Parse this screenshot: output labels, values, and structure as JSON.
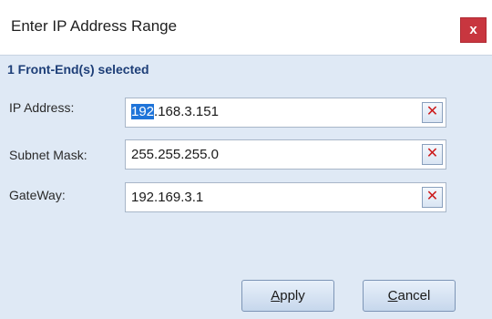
{
  "window": {
    "title": "Enter IP Address Range",
    "close_label": "x"
  },
  "form": {
    "selected_text": "1 Front-End(s) selected",
    "rows": [
      {
        "label": "IP Address:",
        "value": "192.168.3.151",
        "selected_part": "192",
        "rest_part": ".168.3.151"
      },
      {
        "label": "Subnet Mask:",
        "value": "255.255.255.0"
      },
      {
        "label": "GateWay:",
        "value": "192.169.3.1"
      }
    ],
    "clear_icon": "✕"
  },
  "buttons": {
    "apply_first": "A",
    "apply_rest": "pply",
    "cancel_first": "C",
    "cancel_rest": "ancel"
  }
}
